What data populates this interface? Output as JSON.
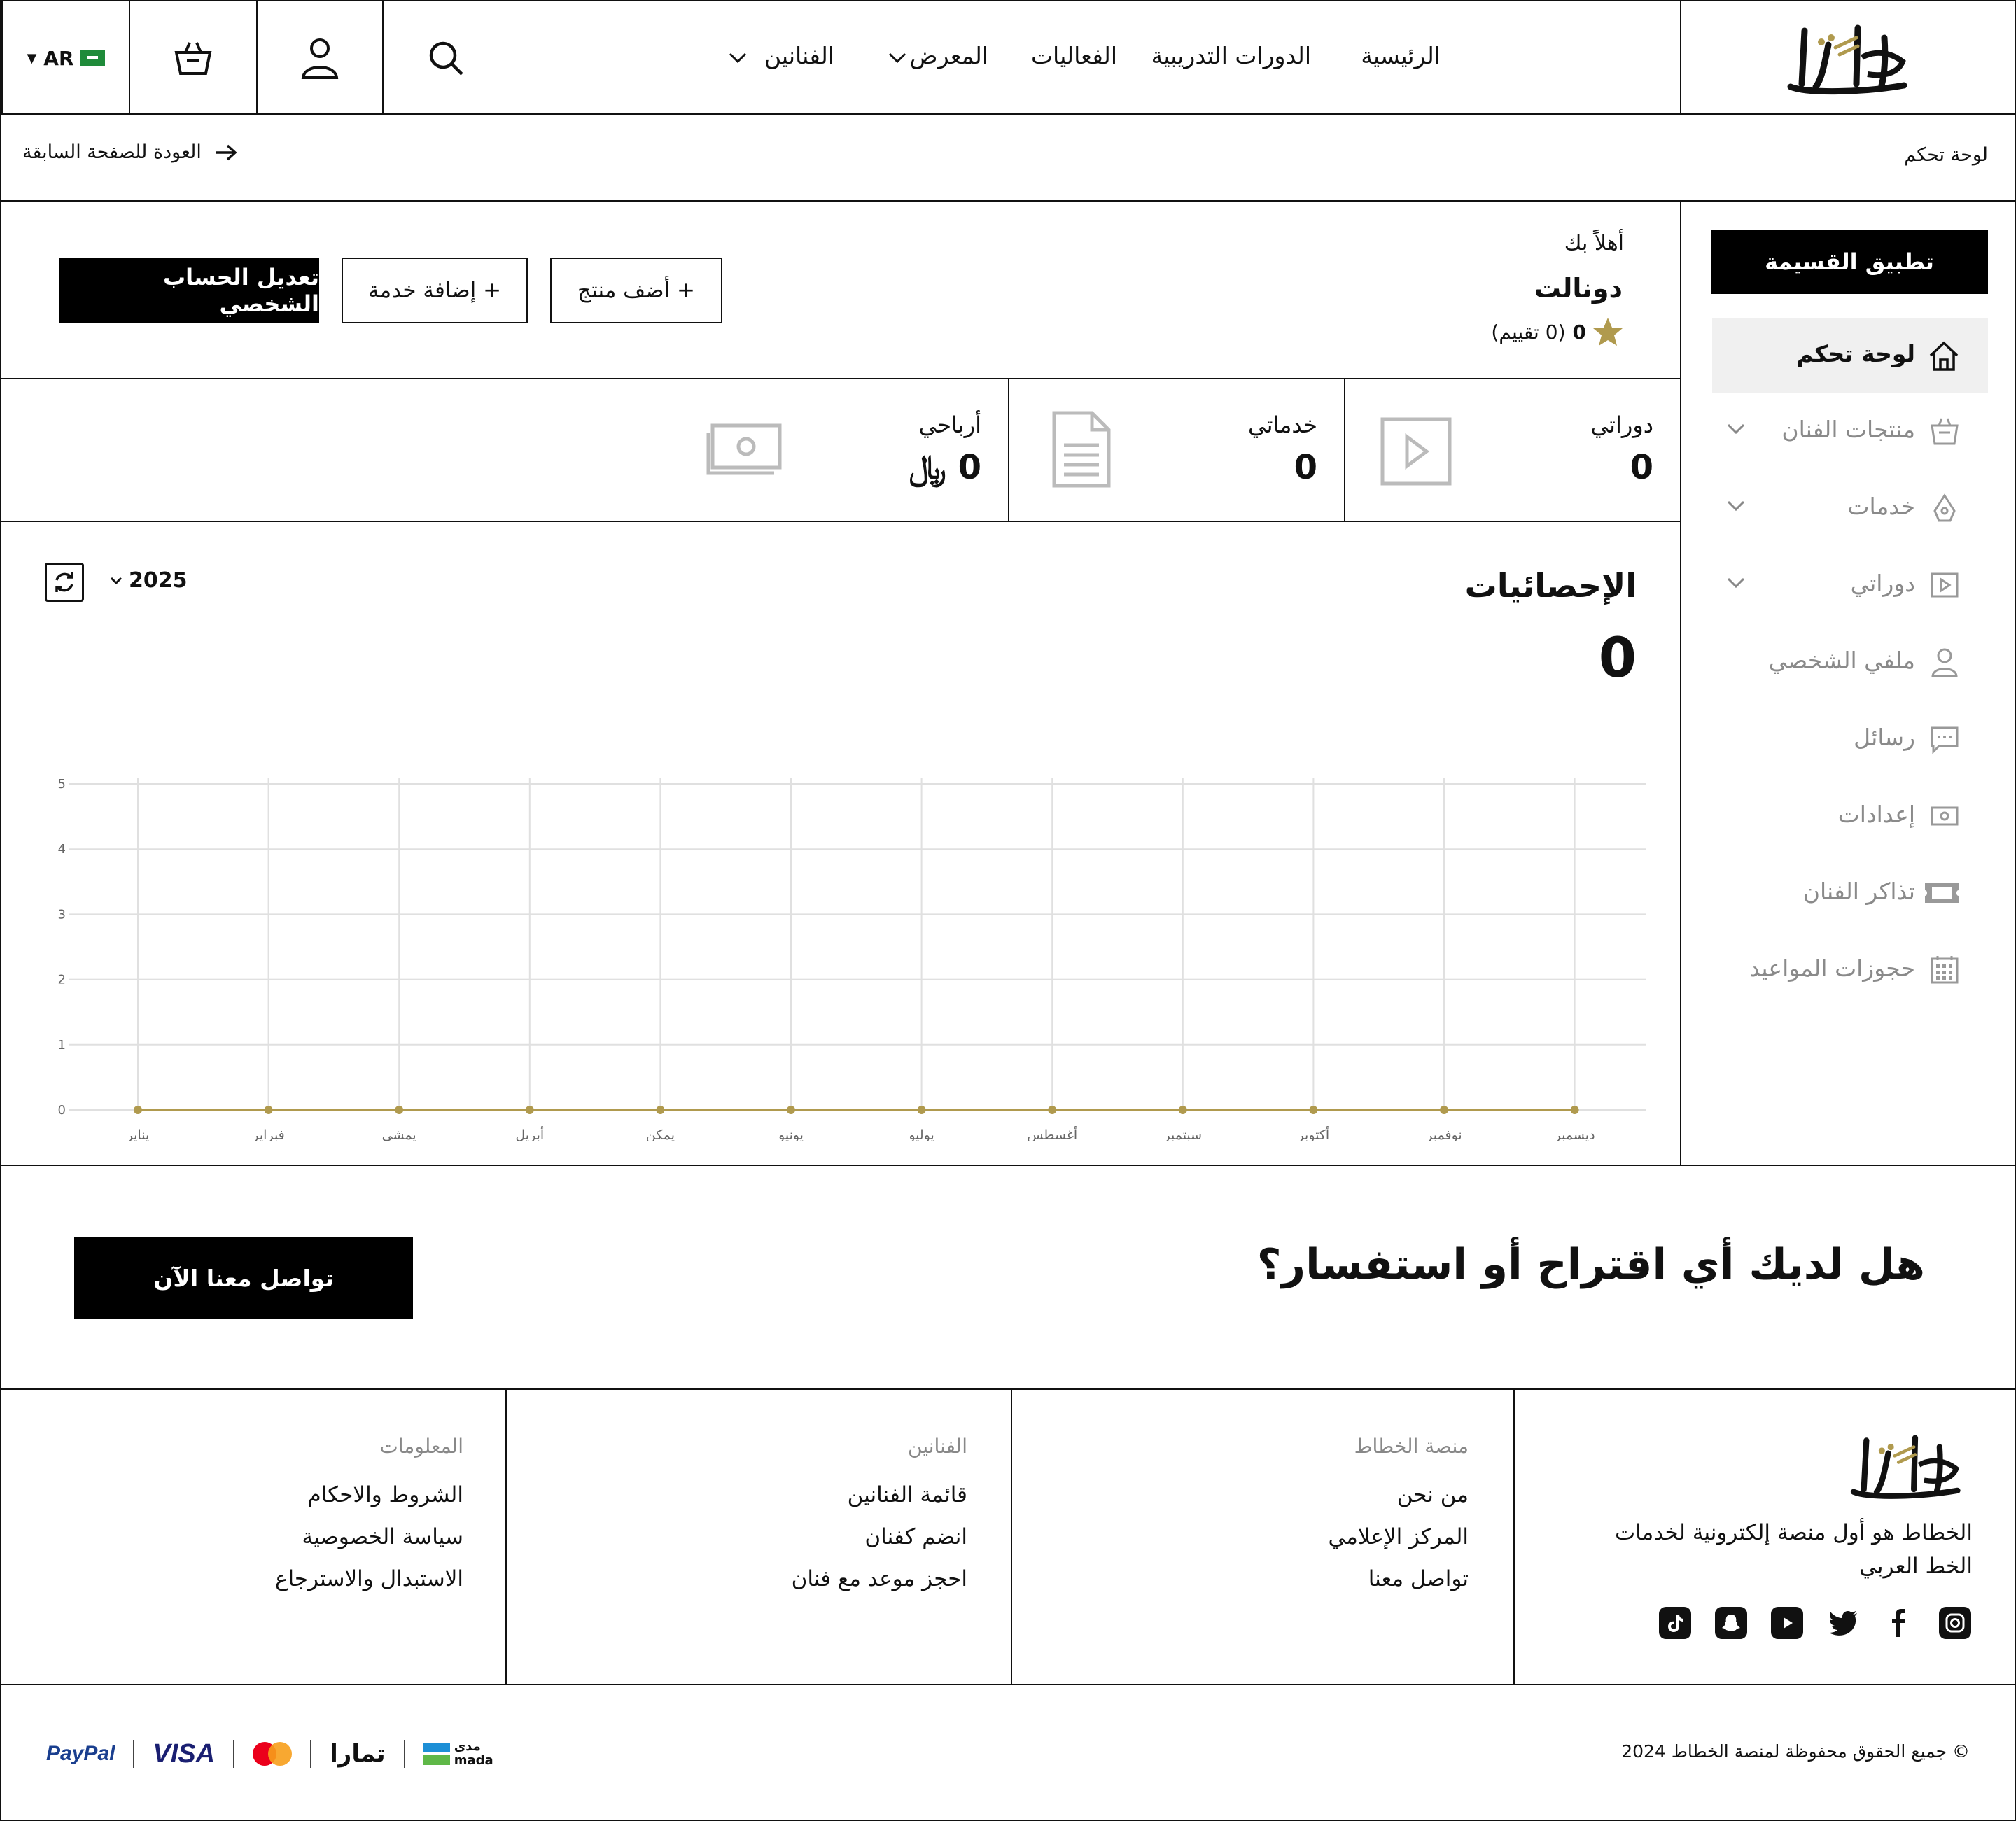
{
  "header": {
    "nav": [
      "الرئيسية",
      "الدورات التدريبية",
      "الفعاليات",
      "المعرض",
      "الفنانين"
    ],
    "language": "AR"
  },
  "breadcrumb": {
    "current": "لوحة تحكم",
    "back": "العودة للصفحة السابقة"
  },
  "sidebar": {
    "coupon_button": "تطبيق القسيمة",
    "items": [
      {
        "label": "لوحة تحكم",
        "icon": "home-icon",
        "active": true
      },
      {
        "label": "منتجات الفنان",
        "icon": "bag-icon",
        "expandable": true
      },
      {
        "label": "خدمات",
        "icon": "pen-nib-icon",
        "expandable": true
      },
      {
        "label": "دوراتي",
        "icon": "play-icon",
        "expandable": true
      },
      {
        "label": "ملفي الشخصي",
        "icon": "user-icon"
      },
      {
        "label": "رسائل",
        "icon": "message-icon"
      },
      {
        "label": "إعدادات",
        "icon": "cash-icon"
      },
      {
        "label": "تذاكر الفنان",
        "icon": "ticket-icon"
      },
      {
        "label": "حجوزات المواعيد",
        "icon": "calendar-icon"
      }
    ]
  },
  "profile": {
    "greeting": "أهلاً بك",
    "name": "دونالت",
    "rating_value": "0",
    "rating_text": "(0 تقييم)"
  },
  "actions": {
    "edit_profile": "تعديل الحساب الشخصي",
    "add_service": "+ إضافة خدمة",
    "add_product": "+ أضف منتج"
  },
  "stats": [
    {
      "label": "دوراتي",
      "value": "0"
    },
    {
      "label": "خدماتي",
      "value": "0"
    },
    {
      "label": "أرباحي",
      "value": "0 ﷼"
    }
  ],
  "statistics": {
    "title": "الإحصائيات",
    "total": "0",
    "year": "2025"
  },
  "chart_data": {
    "type": "line",
    "categories": [
      "يناير",
      "فبراير",
      "يمشي",
      "أبريل",
      "يمكن",
      "يونيو",
      "يوليو",
      "أغسطس",
      "سبتمبر",
      "أكتوبر",
      "نوفمبر",
      "ديسمبر"
    ],
    "values": [
      0,
      0,
      0,
      0,
      0,
      0,
      0,
      0,
      0,
      0,
      0,
      0
    ],
    "yticks": [
      "0",
      "1",
      "2",
      "3",
      "4",
      "5"
    ],
    "ylim": [
      0,
      5
    ],
    "grid": true,
    "color": "#b09a4e"
  },
  "cta": {
    "question": "هل لديك أي اقتراح أو استفسار؟",
    "button": "تواصل معنا الآن"
  },
  "footer": {
    "about": "الخطاط هو أول منصة إلكترونية لخدمات الخط العربي",
    "columns": [
      {
        "title": "منصة الخطاط",
        "links": [
          "من نحن",
          "المركز الإعلامي",
          "تواصل معنا"
        ]
      },
      {
        "title": "الفنانين",
        "links": [
          "قائمة الفنانين",
          "انضم كفنان",
          "احجز موعد مع فنان"
        ]
      },
      {
        "title": "المعلومات",
        "links": [
          "الشروط والاحكام",
          "سياسة الخصوصية",
          "الاستبدال والاسترجاع"
        ]
      }
    ],
    "copyright": "© جميع الحقوق محفوظة لمنصة الخطاط 2024",
    "payments": [
      "PayPal",
      "VISA",
      "mastercard",
      "تمارا",
      "مدى mada"
    ]
  },
  "colors": {
    "accent": "#b09a4e",
    "active_bg": "#f0f0f0"
  }
}
